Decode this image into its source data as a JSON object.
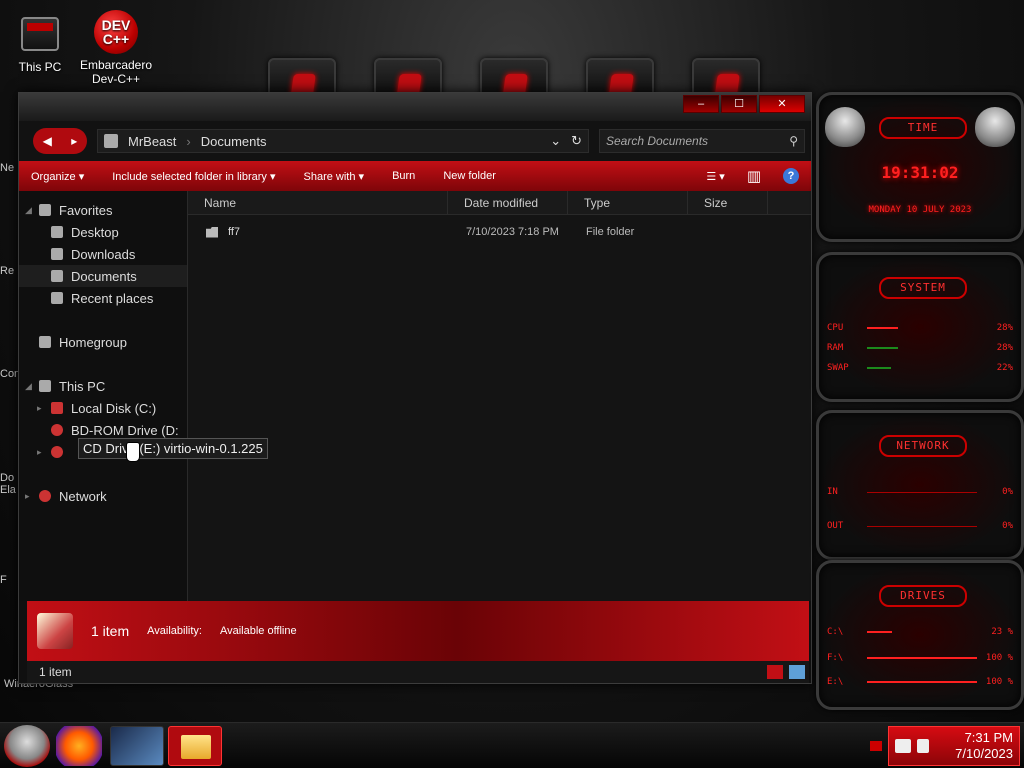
{
  "desktop": {
    "icons": [
      {
        "label": "This PC"
      },
      {
        "label": "Embarcadero Dev-C++",
        "glyph_text_top": "DEV",
        "glyph_text_bottom": "C++"
      }
    ],
    "left_strip_labels": [
      "Ne",
      "Re",
      "Con",
      "Do Ela",
      "F",
      "WinaeroGlass"
    ]
  },
  "window": {
    "controls": {
      "minimize": "–",
      "maximize": "☐",
      "close": "✕"
    },
    "nav": {
      "back": "◀",
      "forward": "▸"
    },
    "address": {
      "segments": [
        "MrBeast",
        "Documents"
      ],
      "dropdown": "⌄",
      "refresh": "↻"
    },
    "search": {
      "placeholder": "Search Documents",
      "icon": "⚲"
    },
    "toolbar": {
      "organize": "Organize ▾",
      "include_library": "Include selected folder in library ▾",
      "share_with": "Share with ▾",
      "burn": "Burn",
      "new_folder": "New folder",
      "views": "☰ ▾",
      "preview": "▥",
      "help": "?"
    },
    "nav_pane": {
      "favorites": "Favorites",
      "desktop": "Desktop",
      "downloads": "Downloads",
      "documents": "Documents",
      "recent": "Recent places",
      "homegroup": "Homegroup",
      "thispc": "This PC",
      "local_disk": "Local Disk (C:)",
      "bd_rom": "BD-ROM Drive (D:",
      "cd_drive": "CD Drive (E:) virtio-win-0.1.225",
      "network": "Network"
    },
    "columns": {
      "name": "Name",
      "date": "Date modified",
      "type": "Type",
      "size": "Size"
    },
    "files": [
      {
        "name": "ff7",
        "date": "7/10/2023 7:18 PM",
        "type": "File folder",
        "size": ""
      }
    ],
    "details": {
      "count": "1 item",
      "availability_label": "Availability:",
      "availability_value": "Available offline"
    },
    "status": {
      "text": "1 item"
    }
  },
  "gadgets": {
    "time": {
      "title": "TIME",
      "clock": "19:31:02",
      "date": "MONDAY 10 JULY 2023"
    },
    "system": {
      "title": "SYSTEM",
      "rows": [
        {
          "label": "CPU",
          "value": "28%"
        },
        {
          "label": "RAM",
          "value": "28%"
        },
        {
          "label": "SWAP",
          "value": "22%"
        }
      ]
    },
    "network": {
      "title": "NETWORK",
      "rows": [
        {
          "label": "IN",
          "value": "0%"
        },
        {
          "label": "OUT",
          "value": "0%"
        }
      ]
    },
    "drives": {
      "title": "DRIVES",
      "rows": [
        {
          "label": "C:\\",
          "value": "23 %"
        },
        {
          "label": "F:\\",
          "value": "100 %"
        },
        {
          "label": "E:\\",
          "value": "100 %"
        }
      ]
    },
    "accent": "#ff2020"
  },
  "taskbar": {
    "tray_time": "7:31 PM",
    "tray_date": "7/10/2023",
    "icons": [
      "alien-start-icon",
      "firefox-icon",
      "ff7-game-icon",
      "file-explorer-icon"
    ]
  },
  "colors": {
    "accent_red": "#c20f15",
    "dark_red": "#7e0509",
    "window_bg": "#141414"
  }
}
